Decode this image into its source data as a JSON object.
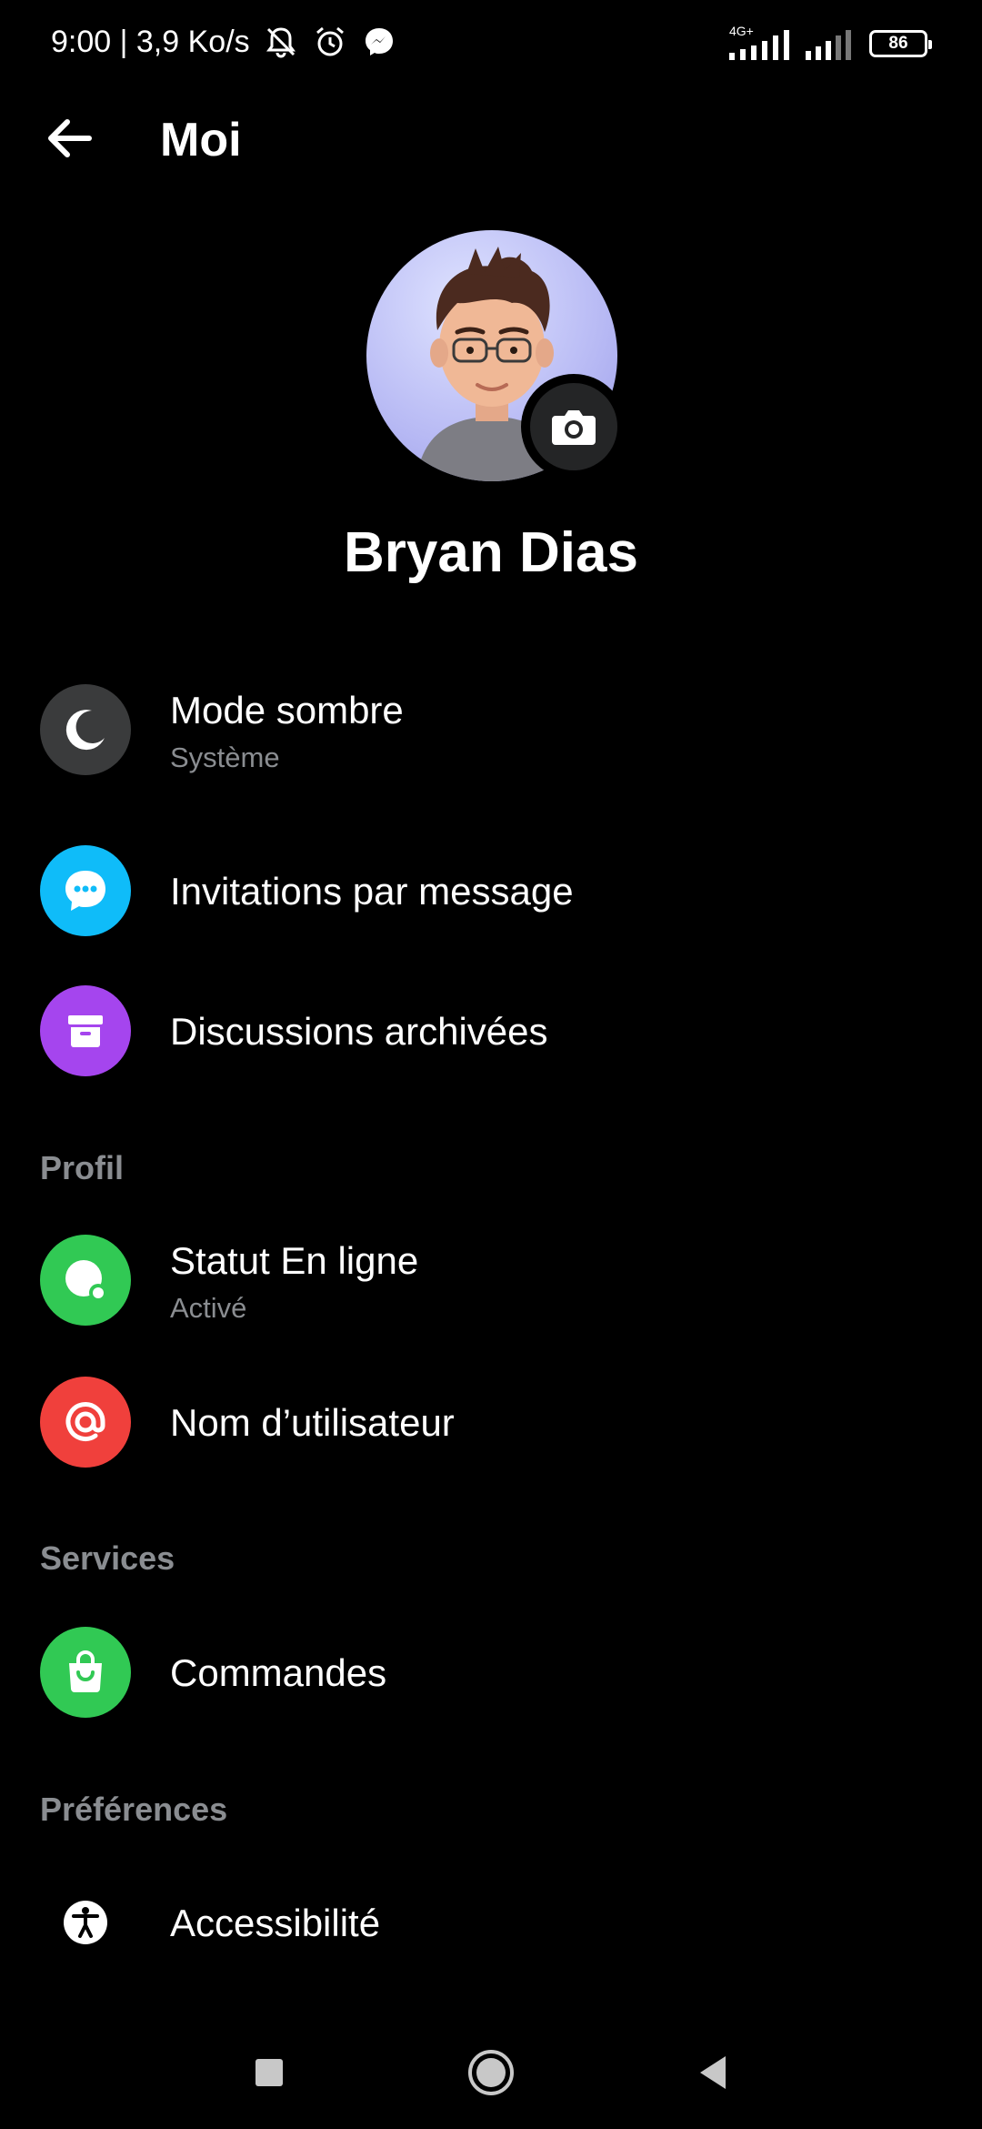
{
  "status_bar": {
    "time_and_speed": "9:00 | 3,9 Ko/s",
    "network_label": "4G+",
    "battery": "86"
  },
  "header": {
    "title": "Moi"
  },
  "profile": {
    "name": "Bryan Dias"
  },
  "menu": {
    "dark_mode": {
      "label": "Mode sombre",
      "value": "Système",
      "icon": "moon-icon",
      "color": "#3a3b3c"
    },
    "message_requests": {
      "label": "Invitations par message",
      "icon": "chat-bubble-icon",
      "color": "#0fbcf9"
    },
    "archived": {
      "label": "Discussions archivées",
      "icon": "archive-box-icon",
      "color": "#a545ee"
    }
  },
  "sections": {
    "profil": {
      "title": "Profil",
      "active_status": {
        "label": "Statut En ligne",
        "value": "Activé",
        "icon": "active-status-icon",
        "color": "#31c954"
      },
      "username": {
        "label": "Nom d’utilisateur",
        "icon": "at-sign-icon",
        "color": "#f0403c"
      }
    },
    "services": {
      "title": "Services",
      "orders": {
        "label": "Commandes",
        "icon": "shopping-bag-icon",
        "color": "#31c954"
      }
    },
    "preferences": {
      "title": "Préférences",
      "accessibility": {
        "label": "Accessibilité",
        "icon": "accessibility-icon"
      }
    }
  },
  "navigation": {
    "recent_icon": "square-icon",
    "home_icon": "circle-home-icon",
    "back_icon": "triangle-back-icon"
  }
}
